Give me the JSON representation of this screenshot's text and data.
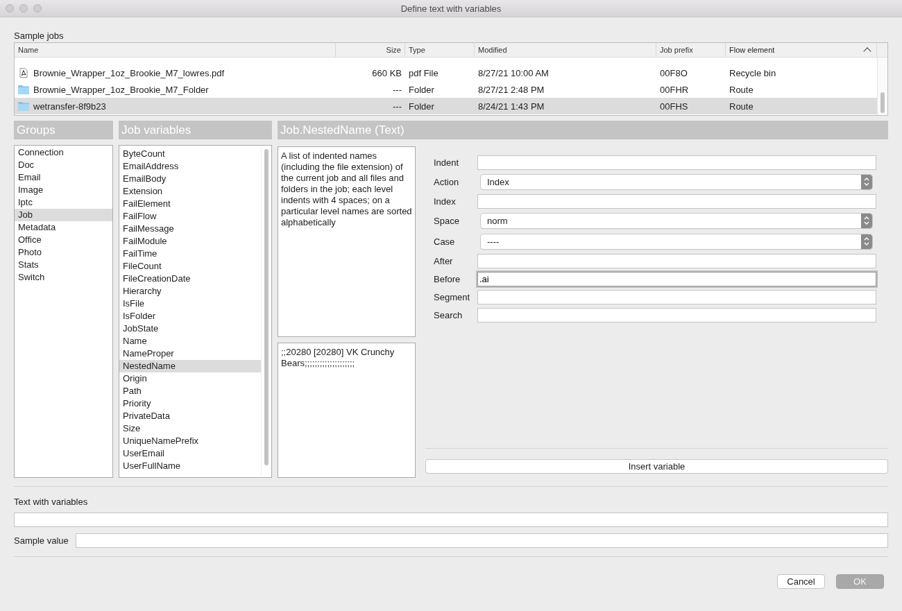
{
  "window": {
    "title": "Define text with variables"
  },
  "sample_jobs": {
    "label": "Sample jobs",
    "columns": [
      {
        "label": "Name",
        "sorted": false
      },
      {
        "label": "Size",
        "sorted": false
      },
      {
        "label": "Type",
        "sorted": false
      },
      {
        "label": "Modified",
        "sorted": false
      },
      {
        "label": "Job prefix",
        "sorted": false
      },
      {
        "label": "Flow element",
        "sorted": true
      }
    ],
    "rows": [
      {
        "kind": "pdf",
        "cells": [
          "Brownie_Wrapper_1oz_Brookie_M7_lowres.pdf",
          "660 KB",
          "pdf File",
          "8/27/21 10:00 AM",
          "00F8O",
          "Recycle bin"
        ],
        "selected": false
      },
      {
        "kind": "folder",
        "cells": [
          "Brownie_Wrapper_1oz_Brookie_M7_Folder",
          "---",
          "Folder",
          "8/27/21 2:48 PM",
          "00FHR",
          "Route"
        ],
        "selected": false
      },
      {
        "kind": "folder",
        "cells": [
          "wetransfer-8f9b23",
          "---",
          "Folder",
          "8/24/21 1:43 PM",
          "00FHS",
          "Route"
        ],
        "selected": true
      }
    ]
  },
  "groups": {
    "title": "Groups",
    "items": [
      {
        "label": "Connection",
        "selected": false
      },
      {
        "label": "Doc",
        "selected": false
      },
      {
        "label": "Email",
        "selected": false
      },
      {
        "label": "Image",
        "selected": false
      },
      {
        "label": "Iptc",
        "selected": false
      },
      {
        "label": "Job",
        "selected": true
      },
      {
        "label": "Metadata",
        "selected": false
      },
      {
        "label": "Office",
        "selected": false
      },
      {
        "label": "Photo",
        "selected": false
      },
      {
        "label": "Stats",
        "selected": false
      },
      {
        "label": "Switch",
        "selected": false
      }
    ]
  },
  "variables": {
    "title": "Job variables",
    "items": [
      {
        "label": "ByteCount",
        "selected": false
      },
      {
        "label": "EmailAddress",
        "selected": false
      },
      {
        "label": "EmailBody",
        "selected": false
      },
      {
        "label": "Extension",
        "selected": false
      },
      {
        "label": "FailElement",
        "selected": false
      },
      {
        "label": "FailFlow",
        "selected": false
      },
      {
        "label": "FailMessage",
        "selected": false
      },
      {
        "label": "FailModule",
        "selected": false
      },
      {
        "label": "FailTime",
        "selected": false
      },
      {
        "label": "FileCount",
        "selected": false
      },
      {
        "label": "FileCreationDate",
        "selected": false
      },
      {
        "label": "Hierarchy",
        "selected": false
      },
      {
        "label": "IsFile",
        "selected": false
      },
      {
        "label": "IsFolder",
        "selected": false
      },
      {
        "label": "JobState",
        "selected": false
      },
      {
        "label": "Name",
        "selected": false
      },
      {
        "label": "NameProper",
        "selected": false
      },
      {
        "label": "NestedName",
        "selected": true
      },
      {
        "label": "Origin",
        "selected": false
      },
      {
        "label": "Path",
        "selected": false
      },
      {
        "label": "Priority",
        "selected": false
      },
      {
        "label": "PrivateData",
        "selected": false
      },
      {
        "label": "Size",
        "selected": false
      },
      {
        "label": "UniqueNamePrefix",
        "selected": false
      },
      {
        "label": "UserEmail",
        "selected": false
      },
      {
        "label": "UserFullName",
        "selected": false
      }
    ]
  },
  "detail": {
    "title": "Job.NestedName (Text)",
    "description": "A list of indented names (including the file extension) of the current job and all files and folders in the job; each level indents with 4 spaces; on a particular level names are sorted alphabetically",
    "sample": ";;20280 [20280] VK Crunchy Bears;;;;;;;;;;;;;;;;;;;;",
    "fields": [
      {
        "kind": "text",
        "label": "Indent",
        "focused": false
      },
      {
        "kind": "select",
        "label": "Action",
        "value": "Index"
      },
      {
        "kind": "text",
        "label": "Index",
        "focused": false
      },
      {
        "kind": "select",
        "label": "Space",
        "value": "norm"
      },
      {
        "kind": "select",
        "label": "Case",
        "value": "----"
      },
      {
        "kind": "text",
        "label": "After",
        "focused": false
      },
      {
        "kind": "text",
        "label": "Before",
        "value": ".ai",
        "focused": true
      },
      {
        "kind": "text",
        "label": "Segment",
        "focused": false
      },
      {
        "kind": "text",
        "label": "Search",
        "focused": false
      }
    ],
    "insert_button": "Insert variable"
  },
  "text_with_variables": {
    "label": "Text with variables"
  },
  "sample_value": {
    "label": "Sample value"
  },
  "buttons": [
    {
      "label": "Cancel",
      "disabled": false
    },
    {
      "label": "OK",
      "disabled": true
    }
  ]
}
